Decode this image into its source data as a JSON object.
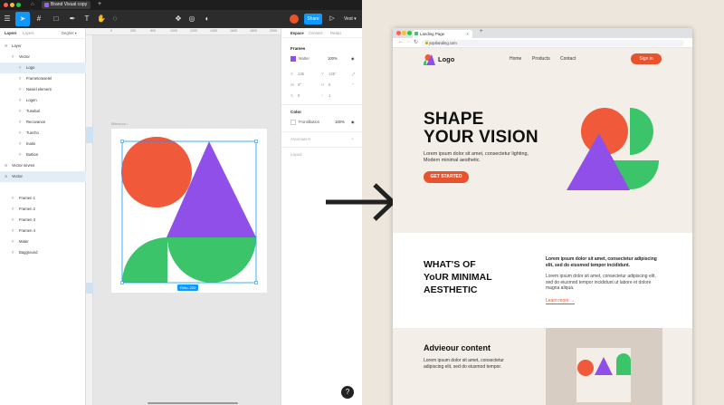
{
  "window": {
    "file_tab": "Brand Visual copy",
    "add_tab": "+"
  },
  "toolbar": {
    "share_label": "Share",
    "zoom_label": "Vest",
    "avatar_color": "#e8532d",
    "accent": "#0d99ff"
  },
  "layers_panel": {
    "tab_layers": "Layers",
    "tab_assets": "Layers",
    "page_selector": "Deghet",
    "items": [
      {
        "label": "Layer",
        "depth": 0
      },
      {
        "label": "Vector",
        "depth": 1
      },
      {
        "label": "Logo",
        "depth": 2,
        "selected": true
      },
      {
        "label": "Frametorasetel",
        "depth": 2
      },
      {
        "label": "Nasiel element",
        "depth": 2
      },
      {
        "label": "Logen",
        "depth": 2
      },
      {
        "label": "Tusebal",
        "depth": 2
      },
      {
        "label": "Recovanon",
        "depth": 2
      },
      {
        "label": "Tuecho",
        "depth": 2
      },
      {
        "label": "Inatio",
        "depth": 2
      },
      {
        "label": "Buttion",
        "depth": 2
      },
      {
        "label": "Vector sevres",
        "depth": 0
      },
      {
        "label": "Vector",
        "depth": 0,
        "selected": true
      },
      {
        "label": "Framen 1",
        "depth": 1
      },
      {
        "label": "Framen 2",
        "depth": 1
      },
      {
        "label": "Framen 3",
        "depth": 1
      },
      {
        "label": "Framen 4",
        "depth": 1
      },
      {
        "label": "Mater",
        "depth": 1
      },
      {
        "label": "Bagground",
        "depth": 1
      }
    ]
  },
  "ruler": {
    "ticks": [
      "0",
      "200",
      "800",
      "1000",
      "1200",
      "1400",
      "1600",
      "1800",
      "2000"
    ]
  },
  "canvas": {
    "artboard_label": "Bitemoor",
    "size_badge": "Retu: 220"
  },
  "properties": {
    "tab_design": "Espace",
    "tab_comment": "Connect",
    "tab_prototype": "Resipi",
    "frames_title": "Frames",
    "frame_name": "Matter",
    "frame_opacity": "100%",
    "x_value": "135",
    "y_value": "125°",
    "w_value": "0°",
    "h_value": "0",
    "r_value": "0",
    "r2_value": "1",
    "color_title": "Color",
    "color_name": "Frontilbution",
    "color_opacity": "100%",
    "appearance_title": "Asconiarent",
    "layout_title": "Layout"
  },
  "browser": {
    "tab_title": "Landing Page",
    "url": "yoprlanding.com"
  },
  "site": {
    "logo_text": "Logo",
    "nav_links": [
      "Home",
      "Products",
      "Contact"
    ],
    "signin_label": "Sign in",
    "hero_title_line1": "SHAPE",
    "hero_title_line2": "YOUR VISION",
    "hero_subtitle": "Lorem ipsum dolor sit amet, consectetur lighting, Modern minimal aesthetic.",
    "hero_button": "GET STARTED",
    "sec2_title_line1": "WHAT'S OF",
    "sec2_title_line2": "YoUR MINIMAL",
    "sec2_title_line3": "AESTHETIC",
    "sec2_bold": "Lorem ipsum dolor sit amet, consectetur adipiscing elit, sed do eiusmod tempor incididunt.",
    "sec2_body": "Lorem ipsum dolor sit amet, consectetur adipiscing elit, sed do eiusmod tempor incididunt ut labore et dolore magna aliqua.",
    "learn_more": "Learn more →",
    "sec3_title": "Adviеour content",
    "sec3_body": "Lorem ipsum dolor sit amet, consectetur adipiscing elit, sed do eiusmod tempor.",
    "colors": {
      "orange": "#f05a3a",
      "purple": "#8f4fe8",
      "green": "#3cc46a",
      "cta": "#e8532d",
      "bg": "#f3eee7"
    }
  },
  "help_label": "?"
}
